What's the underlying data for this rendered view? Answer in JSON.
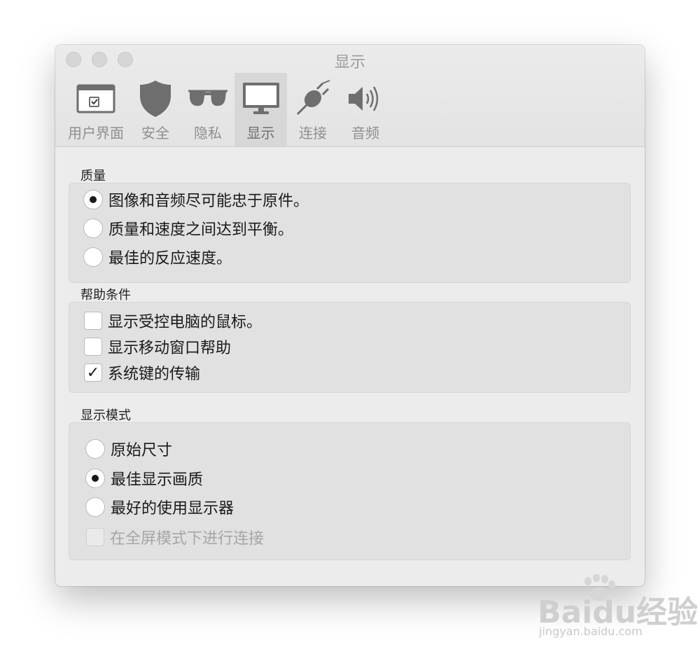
{
  "window": {
    "title": "显示"
  },
  "toolbar": {
    "tabs": [
      {
        "label": "用户界面",
        "icon": "window-icon"
      },
      {
        "label": "安全",
        "icon": "shield-icon"
      },
      {
        "label": "隐私",
        "icon": "sunglasses-icon"
      },
      {
        "label": "显示",
        "icon": "monitor-icon",
        "active": true
      },
      {
        "label": "连接",
        "icon": "plug-icon"
      },
      {
        "label": "音频",
        "icon": "speaker-icon"
      }
    ]
  },
  "quality": {
    "title": "质量",
    "options": [
      {
        "label": "图像和音频尽可能忠于原件。",
        "selected": true
      },
      {
        "label": "质量和速度之间达到平衡。",
        "selected": false
      },
      {
        "label": "最佳的反应速度。",
        "selected": false
      }
    ]
  },
  "help": {
    "title": "帮助条件",
    "options": [
      {
        "label": "显示受控电脑的鼠标。",
        "checked": false
      },
      {
        "label": "显示移动窗口帮助",
        "checked": false
      },
      {
        "label": "系统键的传输",
        "checked": true,
        "check_glyph": "✓"
      }
    ]
  },
  "display_mode": {
    "title": "显示模式",
    "options": [
      {
        "label": "原始尺寸",
        "selected": false
      },
      {
        "label": "最佳显示画质",
        "selected": true
      },
      {
        "label": "最好的使用显示器",
        "selected": false
      }
    ],
    "fullscreen": {
      "label": "在全屏模式下进行连接",
      "checked": false,
      "enabled": false
    }
  },
  "watermark": {
    "main": "Baidu经验",
    "sub": "jingyan.baidu.com"
  },
  "colors": {
    "window_bg": "#ececec",
    "group_bg": "#e1e1e1",
    "active_tab_bg": "#d7d7d7",
    "icon_gray": "#6e6e6e"
  }
}
